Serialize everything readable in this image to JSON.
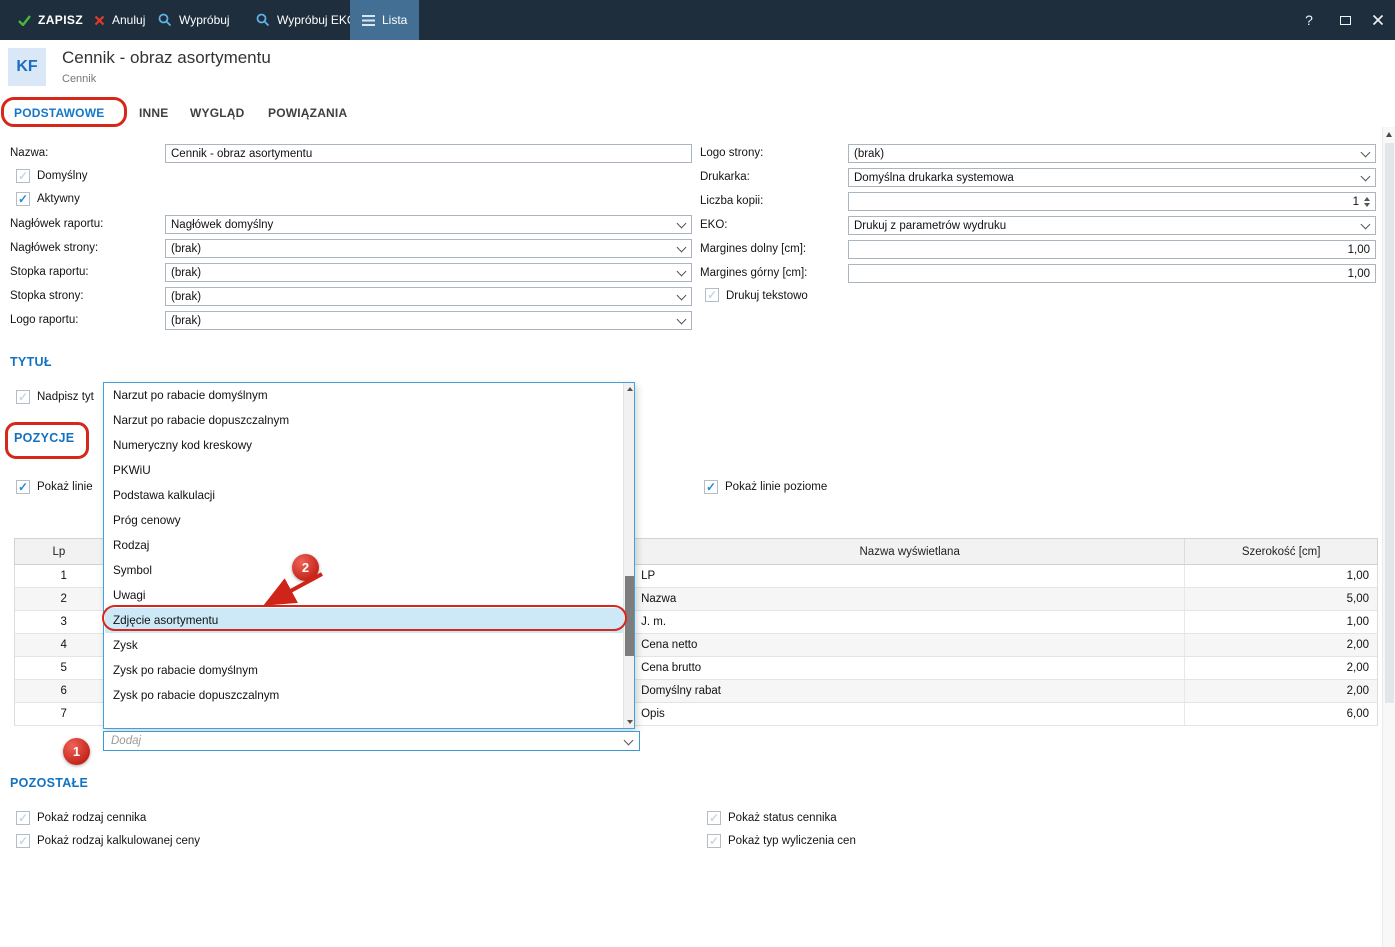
{
  "toolbar": {
    "save": "ZAPISZ",
    "cancel": "Anuluj",
    "tryout": "Wypróbuj",
    "tryout_eko": "Wypróbuj EKO",
    "list": "Lista",
    "help": "?"
  },
  "header": {
    "badge": "KF",
    "title": "Cennik - obraz asortymentu",
    "subtitle": "Cennik"
  },
  "tabs": {
    "podstawowe": "PODSTAWOWE",
    "inne": "INNE",
    "wyglad": "WYGLĄD",
    "powiazania": "POWIĄZANIA"
  },
  "form": {
    "nazwa_label": "Nazwa:",
    "nazwa_value": "Cennik - obraz asortymentu",
    "domyslny_label": "Domyślny",
    "aktywny_label": "Aktywny",
    "naglowek_raportu_label": "Nagłówek raportu:",
    "naglowek_raportu_value": "Nagłówek domyślny",
    "naglowek_strony_label": "Nagłówek strony:",
    "naglowek_strony_value": "(brak)",
    "stopka_raportu_label": "Stopka raportu:",
    "stopka_raportu_value": "(brak)",
    "stopka_strony_label": "Stopka strony:",
    "stopka_strony_value": "(brak)",
    "logo_raportu_label": "Logo raportu:",
    "logo_raportu_value": "(brak)",
    "logo_strony_label": "Logo strony:",
    "logo_strony_value": "(brak)",
    "drukarka_label": "Drukarka:",
    "drukarka_value": "Domyślna drukarka systemowa",
    "liczba_kopii_label": "Liczba kopii:",
    "liczba_kopii_value": "1",
    "eko_label": "EKO:",
    "eko_value": "Drukuj z parametrów wydruku",
    "margines_dolny_label": "Margines dolny [cm]:",
    "margines_dolny_value": "1,00",
    "margines_gorny_label": "Margines górny [cm]:",
    "margines_gorny_value": "1,00",
    "drukuj_tekstowo_label": "Drukuj tekstowo"
  },
  "sections": {
    "tytul": "TYTUŁ",
    "pozycje": "POZYCJE",
    "pozostale": "POZOSTAŁE"
  },
  "tytul": {
    "nadpisz_label": "Nadpisz tyt"
  },
  "pozycje": {
    "pokaz_linie_label": "Pokaż linie",
    "pokaz_linie_poziome_label": "Pokaż linie poziome"
  },
  "dropdown": {
    "items": [
      "Narzut po rabacie domyślnym",
      "Narzut po rabacie dopuszczalnym",
      "Numeryczny kod kreskowy",
      "PKWiU",
      "Podstawa kalkulacji",
      "Próg cenowy",
      "Rodzaj",
      "Symbol",
      "Uwagi",
      "Zdjęcie asortymentu",
      "Zysk",
      "Zysk po rabacie domyślnym",
      "Zysk po rabacie dopuszczalnym"
    ],
    "selected": "Zdjęcie asortymentu",
    "placeholder": "Dodaj"
  },
  "table": {
    "col_lp": "Lp",
    "col_nazwa": "Nazwa wyświetlana",
    "col_szerokosc": "Szerokość [cm]",
    "rows": [
      {
        "lp": "1",
        "nazwa": "LP",
        "szer": "1,00"
      },
      {
        "lp": "2",
        "nazwa": "Nazwa",
        "szer": "5,00"
      },
      {
        "lp": "3",
        "nazwa": "J. m.",
        "szer": "1,00"
      },
      {
        "lp": "4",
        "nazwa": "Cena netto",
        "szer": "2,00"
      },
      {
        "lp": "5",
        "nazwa": "Cena brutto",
        "szer": "2,00"
      },
      {
        "lp": "6",
        "nazwa": "Domyślny rabat",
        "szer": "2,00"
      },
      {
        "lp": "7",
        "nazwa": "Opis",
        "szer": "6,00"
      }
    ]
  },
  "pozostale": {
    "rodzaj_cennika": "Pokaż rodzaj cennika",
    "rodzaj_kalkulowanej": "Pokaż rodzaj kalkulowanej ceny",
    "status_cennika": "Pokaż status cennika",
    "typ_wyliczenia": "Pokaż typ wyliczenia cen"
  },
  "annotations": {
    "badge1": "1",
    "badge2": "2"
  },
  "colors": {
    "toolbar_bg": "#1f2e3d",
    "accent_blue": "#1478c8",
    "annotation_red": "#d5281b",
    "selected_item_bg": "#cde9f8",
    "green_check": "#46b83d",
    "red_x": "#e6392b"
  }
}
